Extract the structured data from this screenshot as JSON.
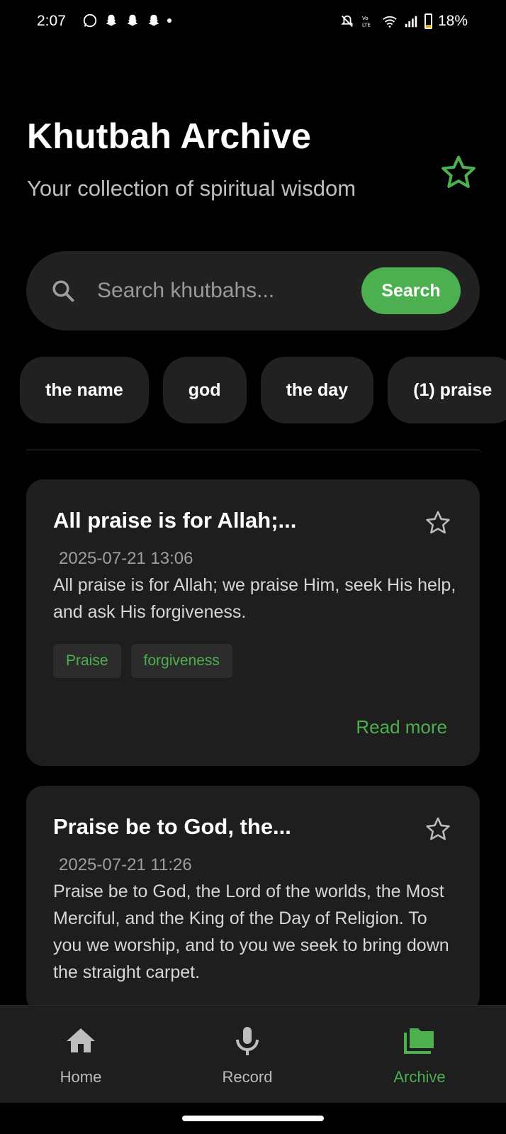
{
  "status_bar": {
    "time": "2:07",
    "battery": "18%"
  },
  "header": {
    "title": "Khutbah Archive",
    "subtitle": "Your collection of spiritual wisdom"
  },
  "search": {
    "placeholder": "Search khutbahs...",
    "button_label": "Search"
  },
  "chips": [
    "the name",
    "god",
    "the day",
    "(1) praise"
  ],
  "cards": [
    {
      "title": "All praise is for Allah;...",
      "date": "2025-07-21 13:06",
      "body": "All praise is for Allah; we praise Him, seek His help, and ask His forgiveness.",
      "tags": [
        "Praise",
        "forgiveness"
      ],
      "read_more": "Read more"
    },
    {
      "title": "Praise be to God, the...",
      "date": "2025-07-21 11:26",
      "body": "Praise be to God, the Lord of the worlds, the Most Merciful, and the King of the Day of Religion. To you we worship, and to you we seek to bring down the straight carpet."
    }
  ],
  "nav": {
    "items": [
      {
        "label": "Home",
        "icon": "home-icon"
      },
      {
        "label": "Record",
        "icon": "microphone-icon"
      },
      {
        "label": "Archive",
        "icon": "folder-icon"
      }
    ],
    "active": "Archive"
  },
  "colors": {
    "accent": "#4caf50",
    "background": "#000000",
    "surface": "#1e1e1e"
  }
}
